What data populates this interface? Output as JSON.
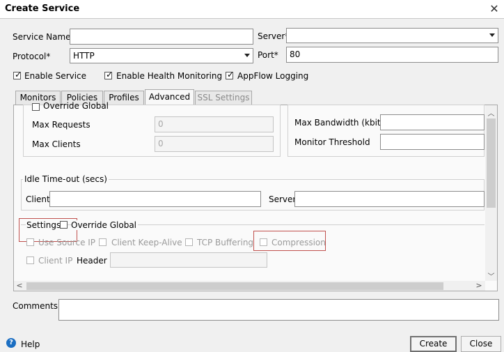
{
  "window": {
    "title": "Create Service",
    "close_glyph": "✕"
  },
  "form": {
    "service_name_label": "Service Name*",
    "service_name_value": "",
    "server_label": "Server*",
    "server_value": "",
    "protocol_label": "Protocol*",
    "protocol_value": "HTTP",
    "port_label": "Port*",
    "port_value": "80"
  },
  "options": {
    "enable_service": "Enable Service",
    "enable_health_monitoring": "Enable Health Monitoring",
    "appflow_logging": "AppFlow Logging",
    "checked_glyph": "✓"
  },
  "tabs": [
    {
      "label": "Monitors"
    },
    {
      "label": "Policies"
    },
    {
      "label": "Profiles"
    },
    {
      "label": "Advanced"
    },
    {
      "label": "SSL Settings"
    }
  ],
  "advanced": {
    "override_global_top": "Override Global",
    "max_requests_label": "Max Requests",
    "max_requests_value": "0",
    "max_clients_label": "Max Clients",
    "max_clients_value": "0",
    "max_bandwidth_label": "Max Bandwidth (kbits)",
    "monitor_threshold_label": "Monitor Threshold",
    "idle_timeout_title": "Idle Time-out (secs)",
    "client_label": "Client",
    "server_label": "Server",
    "settings_title": "Settings",
    "override_global": "Override Global",
    "use_source_ip": "Use Source IP",
    "client_keep_alive": "Client Keep-Alive",
    "tcp_buffering": "TCP Buffering",
    "compression": "Compression",
    "client_ip": "Client IP",
    "header_label": "Header"
  },
  "scroll": {
    "up": "︿",
    "down": "﹀",
    "left": "<",
    "right": ">"
  },
  "bottom": {
    "comments_label": "Comments",
    "help_label": "Help",
    "create_label": "Create",
    "close_label": "Close"
  }
}
